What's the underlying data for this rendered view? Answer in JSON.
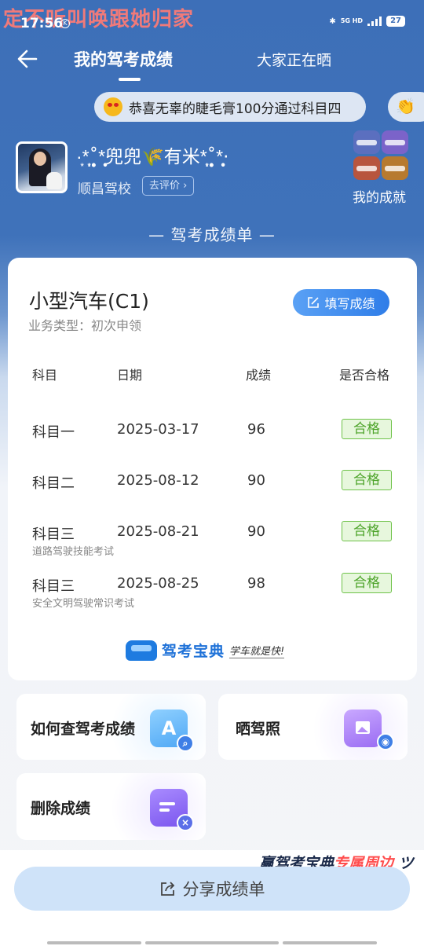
{
  "watermark": "定不听叫唤跟她归家",
  "status_bar": {
    "time": "17:56",
    "network": "5G HD",
    "battery": "27"
  },
  "header": {
    "tab_active": "我的驾考成绩",
    "tab_other": "大家正在晒"
  },
  "ticker": {
    "text": "恭喜无辜的睫毛膏100分通过科目四"
  },
  "profile": {
    "nickname": "·͙*̩̩͙˚̩̥̩̥*̩̩̥͙兜兜🌾有米*̩̩͙˚̩̥̩̥*̩̩̥͙·",
    "school": "顺昌驾校",
    "rate_button": "去评价",
    "achievements_label": "我的成就"
  },
  "section_title": "— 驾考成绩单 —",
  "score_card": {
    "vehicle": "小型汽车(C1)",
    "business_type": "业务类型：初次申领",
    "fill_button": "填写成绩",
    "columns": [
      "科目",
      "日期",
      "成绩",
      "是否合格"
    ],
    "rows": [
      {
        "subject": "科目一",
        "date": "2025-03-17",
        "score": "96",
        "result": "合格",
        "note": ""
      },
      {
        "subject": "科目二",
        "date": "2025-08-12",
        "score": "90",
        "result": "合格",
        "note": ""
      },
      {
        "subject": "科目三",
        "date": "2025-08-21",
        "score": "90",
        "result": "合格",
        "note": "道路驾驶技能考试"
      },
      {
        "subject": "科目三",
        "date": "2025-08-25",
        "score": "98",
        "result": "合格",
        "note": "安全文明驾驶常识考试"
      }
    ],
    "brand_name": "驾考宝典",
    "brand_slogan": "学车就是快!"
  },
  "actions": {
    "query": "如何查驾考成绩",
    "show_license": "晒驾照",
    "delete": "删除成绩"
  },
  "promo": {
    "part1": "赢驾考宝典",
    "part2": "专属周边"
  },
  "share_button": "分享成绩单",
  "icons": {
    "back": "arrow-left-icon",
    "ticker": "star-eyes-emoji-icon",
    "wave": "clap-hands-emoji-icon",
    "edit": "edit-icon",
    "share": "share-icon",
    "query": "document-search-icon",
    "photo": "photo-camera-icon",
    "delete": "document-delete-icon"
  },
  "colors": {
    "header_blue": "#3d6fb8",
    "pass_green": "#4ea42b",
    "brand_blue": "#1f72d8",
    "promo_red": "#ff4d4d"
  }
}
